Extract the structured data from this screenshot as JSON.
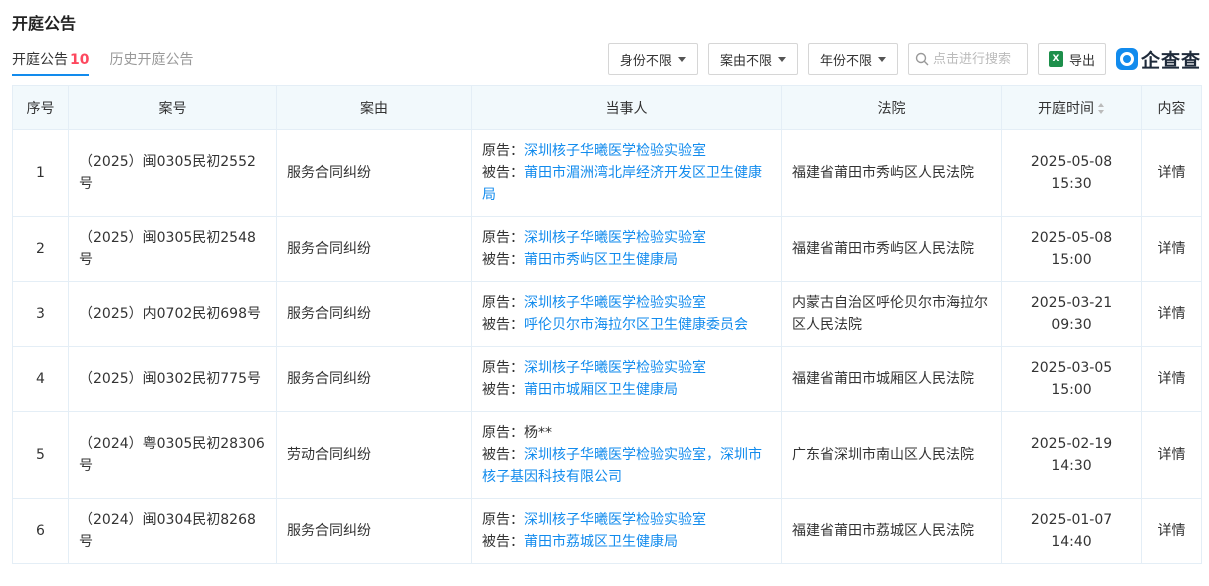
{
  "page_title": "开庭公告",
  "tabs": [
    {
      "label": "开庭公告",
      "count": "10"
    },
    {
      "label": "历史开庭公告"
    }
  ],
  "toolbar": {
    "filter_identity": "身份不限",
    "filter_cause": "案由不限",
    "filter_year": "年份不限",
    "search_placeholder": "点击进行搜索",
    "export_label": "导出",
    "excel_icon_text": "X",
    "logo_text": "企查查"
  },
  "table": {
    "headers": [
      "序号",
      "案号",
      "案由",
      "当事人",
      "法院",
      "开庭时间",
      "内容"
    ],
    "rows": [
      {
        "no": "1",
        "case_no": "（2025）闽0305民初2552号",
        "cause": "服务合同纠纷",
        "plaintiff_label": "原告：",
        "plaintiff": "深圳核子华曦医学检验实验室",
        "defendant_label": "被告：",
        "defendant": "莆田市湄洲湾北岸经济开发区卫生健康局",
        "court": "福建省莆田市秀屿区人民法院",
        "time": "2025-05-08 15:30",
        "detail": "详情"
      },
      {
        "no": "2",
        "case_no": "（2025）闽0305民初2548号",
        "cause": "服务合同纠纷",
        "plaintiff_label": "原告：",
        "plaintiff": "深圳核子华曦医学检验实验室",
        "defendant_label": "被告：",
        "defendant": "莆田市秀屿区卫生健康局",
        "court": "福建省莆田市秀屿区人民法院",
        "time": "2025-05-08 15:00",
        "detail": "详情"
      },
      {
        "no": "3",
        "case_no": "（2025）内0702民初698号",
        "cause": "服务合同纠纷",
        "plaintiff_label": "原告：",
        "plaintiff": "深圳核子华曦医学检验实验室",
        "defendant_label": "被告：",
        "defendant": "呼伦贝尔市海拉尔区卫生健康委员会",
        "court": "内蒙古自治区呼伦贝尔市海拉尔区人民法院",
        "time": "2025-03-21 09:30",
        "detail": "详情"
      },
      {
        "no": "4",
        "case_no": "（2025）闽0302民初775号",
        "cause": "服务合同纠纷",
        "plaintiff_label": "原告：",
        "plaintiff": "深圳核子华曦医学检验实验室",
        "defendant_label": "被告：",
        "defendant": "莆田市城厢区卫生健康局",
        "court": "福建省莆田市城厢区人民法院",
        "time": "2025-03-05 15:00",
        "detail": "详情"
      },
      {
        "no": "5",
        "case_no": "（2024）粤0305民初28306号",
        "cause": "劳动合同纠纷",
        "plaintiff_label": "原告：",
        "plaintiff_plain": "杨**",
        "defendant_label": "被告：",
        "defendant": "深圳核子华曦医学检验实验室",
        "defendant_sep": "，",
        "defendant2": "深圳市核子基因科技有限公司",
        "court": "广东省深圳市南山区人民法院",
        "time": "2025-02-19 14:30",
        "detail": "详情"
      },
      {
        "no": "6",
        "case_no": "（2024）闽0304民初8268号",
        "cause": "服务合同纠纷",
        "plaintiff_label": "原告：",
        "plaintiff": "深圳核子华曦医学检验实验室",
        "defendant_label": "被告：",
        "defendant": "莆田市荔城区卫生健康局",
        "court": "福建省莆田市荔城区人民法院",
        "time": "2025-01-07 14:40",
        "detail": "详情"
      }
    ]
  }
}
